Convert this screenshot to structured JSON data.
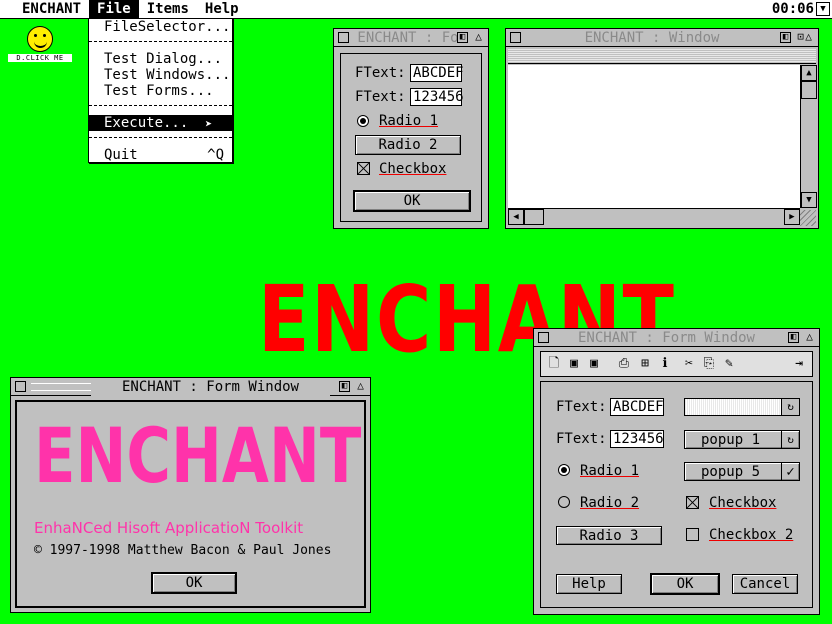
{
  "menubar": {
    "items": [
      "ENCHANT",
      "File",
      "Items",
      "Help"
    ],
    "clock": "00:06"
  },
  "file_menu": {
    "items": [
      "FileSelector...",
      "Test Dialog...",
      "Test Windows...",
      "Test Forms...",
      "Execute...",
      "Quit"
    ],
    "quit_shortcut": "^Q"
  },
  "desktop_icon": {
    "label": "D.CLICK ME",
    "icon": "smiley-icon"
  },
  "win_small_form": {
    "title": "ENCHANT : Fo",
    "ftext1_label": "FText:",
    "ftext1_value": "ABCDEF",
    "ftext2_label": "FText:",
    "ftext2_value": "123456",
    "radio1": "Radio 1",
    "radio2": "Radio 2",
    "checkbox": "Checkbox",
    "ok": "OK"
  },
  "win_window": {
    "title": "ENCHANT : Window"
  },
  "logo": {
    "text": "ENCHANT"
  },
  "win_about": {
    "title": "ENCHANT : Form Window",
    "logo": "ENCHANT",
    "subtitle": "EnhaNCed Hisoft ApplicatioN Toolkit",
    "copyright": "© 1997-1998 Matthew Bacon & Paul Jones",
    "ok": "OK"
  },
  "win_form": {
    "title": "ENCHANT : Form Window",
    "ftext1_label": "FText:",
    "ftext1_value": "ABCDEF",
    "ftext2_label": "FText:",
    "ftext2_value": "123456",
    "popup1": "popup 1",
    "popup5": "popup 5",
    "radio1": "Radio 1",
    "radio2": "Radio 2",
    "radio3": "Radio 3",
    "checkbox": "Checkbox",
    "checkbox2": "Checkbox 2",
    "help": "Help",
    "ok": "OK",
    "cancel": "Cancel",
    "toolbar_icons": [
      "new-file-icon",
      "save-icon",
      "save-as-icon",
      "print-icon",
      "print-preview-icon",
      "info-icon",
      "cut-icon",
      "paste-icon",
      "edit-icon",
      "exit-icon"
    ]
  },
  "colors": {
    "desktop": "#00ff00",
    "logo_red": "#ff0000",
    "logo_pink": "#ff33aa",
    "window": "#c0c0c0"
  }
}
